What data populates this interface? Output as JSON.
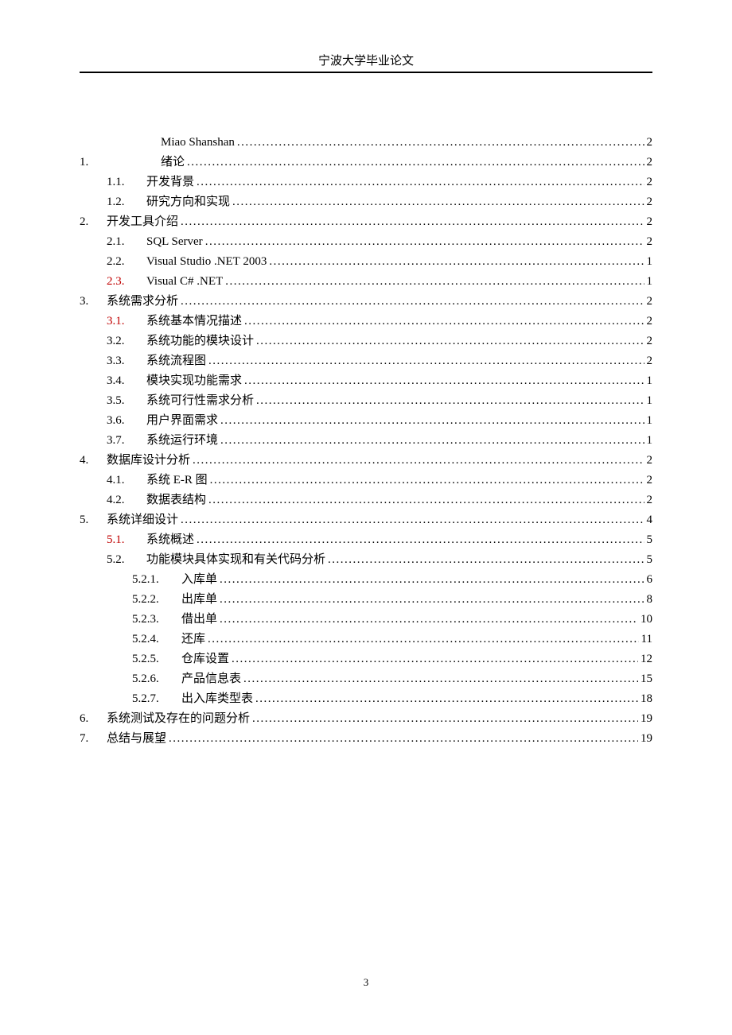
{
  "header": "宁波大学毕业论文",
  "footer": "3",
  "leader_content": "..............................................................................................................................................................................................................................",
  "toc": [
    {
      "level": 1,
      "num": "",
      "title": "Miao Shanshan",
      "page": "2",
      "spacer": true
    },
    {
      "level": 1,
      "num": "1.",
      "title": "绪论",
      "page": "2",
      "spacer": true
    },
    {
      "level": 2,
      "num": "1.1.",
      "title": "开发背景",
      "page": "2"
    },
    {
      "level": 2,
      "num": "1.2.",
      "title": "研究方向和实现",
      "page": "2"
    },
    {
      "level": 1,
      "num": "2.",
      "title": "开发工具介绍",
      "page": "2"
    },
    {
      "level": 2,
      "num": "2.1.",
      "title": "SQL Server",
      "page": "2"
    },
    {
      "level": 2,
      "num": "2.2.",
      "title": "Visual Studio .NET 2003",
      "page": "1"
    },
    {
      "level": 2,
      "num": "2.3.",
      "title": "Visual C# .NET",
      "page": "1",
      "red_num": true
    },
    {
      "level": 1,
      "num": "3.",
      "title": "系统需求分析",
      "page": "2"
    },
    {
      "level": 2,
      "num": "3.1.",
      "title": "系统基本情况描述",
      "page": "2",
      "red_num": true
    },
    {
      "level": 2,
      "num": "3.2.",
      "title": "系统功能的模块设计",
      "page": "2"
    },
    {
      "level": 2,
      "num": "3.3.",
      "title": "系统流程图",
      "page": "2"
    },
    {
      "level": 2,
      "num": "3.4.",
      "title": "模块实现功能需求",
      "page": "1"
    },
    {
      "level": 2,
      "num": "3.5.",
      "title": "系统可行性需求分析",
      "page": "1"
    },
    {
      "level": 2,
      "num": "3.6.",
      "title": "用户界面需求",
      "page": "1"
    },
    {
      "level": 2,
      "num": "3.7.",
      "title": "系统运行环境",
      "page": "1"
    },
    {
      "level": 1,
      "num": "4.",
      "title": "数据库设计分析",
      "page": "2"
    },
    {
      "level": 2,
      "num": "4.1.",
      "title": "系统 E-R 图",
      "page": "2"
    },
    {
      "level": 2,
      "num": "4.2.",
      "title": "数据表结构",
      "page": "2"
    },
    {
      "level": 1,
      "num": "5.",
      "title": "系统详细设计",
      "page": "4"
    },
    {
      "level": 2,
      "num": "5.1.",
      "title": "系统概述",
      "page": "5",
      "red_num": true
    },
    {
      "level": 2,
      "num": "5.2.",
      "title": "功能模块具体实现和有关代码分析",
      "page": "5"
    },
    {
      "level": 3,
      "num": "5.2.1.",
      "title": "入库单",
      "page": "6"
    },
    {
      "level": 3,
      "num": "5.2.2.",
      "title": "出库单",
      "page": "8"
    },
    {
      "level": 3,
      "num": "5.2.3.",
      "title": "借出单",
      "page": "10"
    },
    {
      "level": 3,
      "num": "5.2.4.",
      "title": "还库",
      "page": "11"
    },
    {
      "level": 3,
      "num": "5.2.5.",
      "title": "仓库设置",
      "page": "12"
    },
    {
      "level": 3,
      "num": "5.2.6.",
      "title": "产品信息表",
      "page": "15"
    },
    {
      "level": 3,
      "num": "5.2.7.",
      "title": "出入库类型表",
      "page": "18"
    },
    {
      "level": 1,
      "num": "6.",
      "title": "系统测试及存在的问题分析",
      "page": "19"
    },
    {
      "level": 1,
      "num": "7.",
      "title": "总结与展望",
      "page": "19"
    }
  ]
}
